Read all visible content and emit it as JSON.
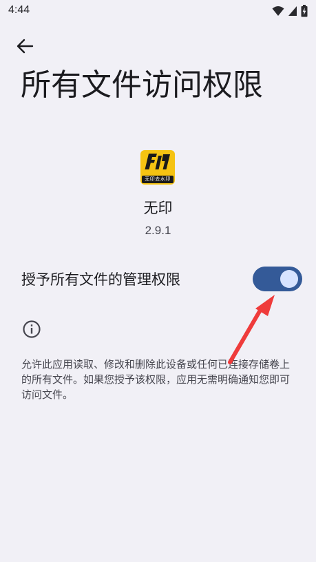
{
  "status_bar": {
    "time": "4:44",
    "icons": [
      "wifi-icon",
      "signal-icon",
      "battery-charging-icon"
    ]
  },
  "header": {
    "back_icon": "arrow-left-icon",
    "title": "所有文件访问权限"
  },
  "app": {
    "icon_caption": "无印去水印",
    "name": "无印",
    "version": "2.9.1"
  },
  "permission": {
    "label": "授予所有文件的管理权限",
    "enabled": true
  },
  "info": {
    "icon": "info-icon",
    "description": "允许此应用读取、修改和删除此设备或任何已连接存储卷上的所有文件。如果您授予该权限，应用无需明确通知您即可访问文件。"
  },
  "colors": {
    "background": "#f1f0f6",
    "toggle_track": "#345a98",
    "toggle_thumb": "#d7e3ff",
    "app_icon_bg": "#f5c312",
    "annotation_arrow": "#ef3b3b"
  }
}
